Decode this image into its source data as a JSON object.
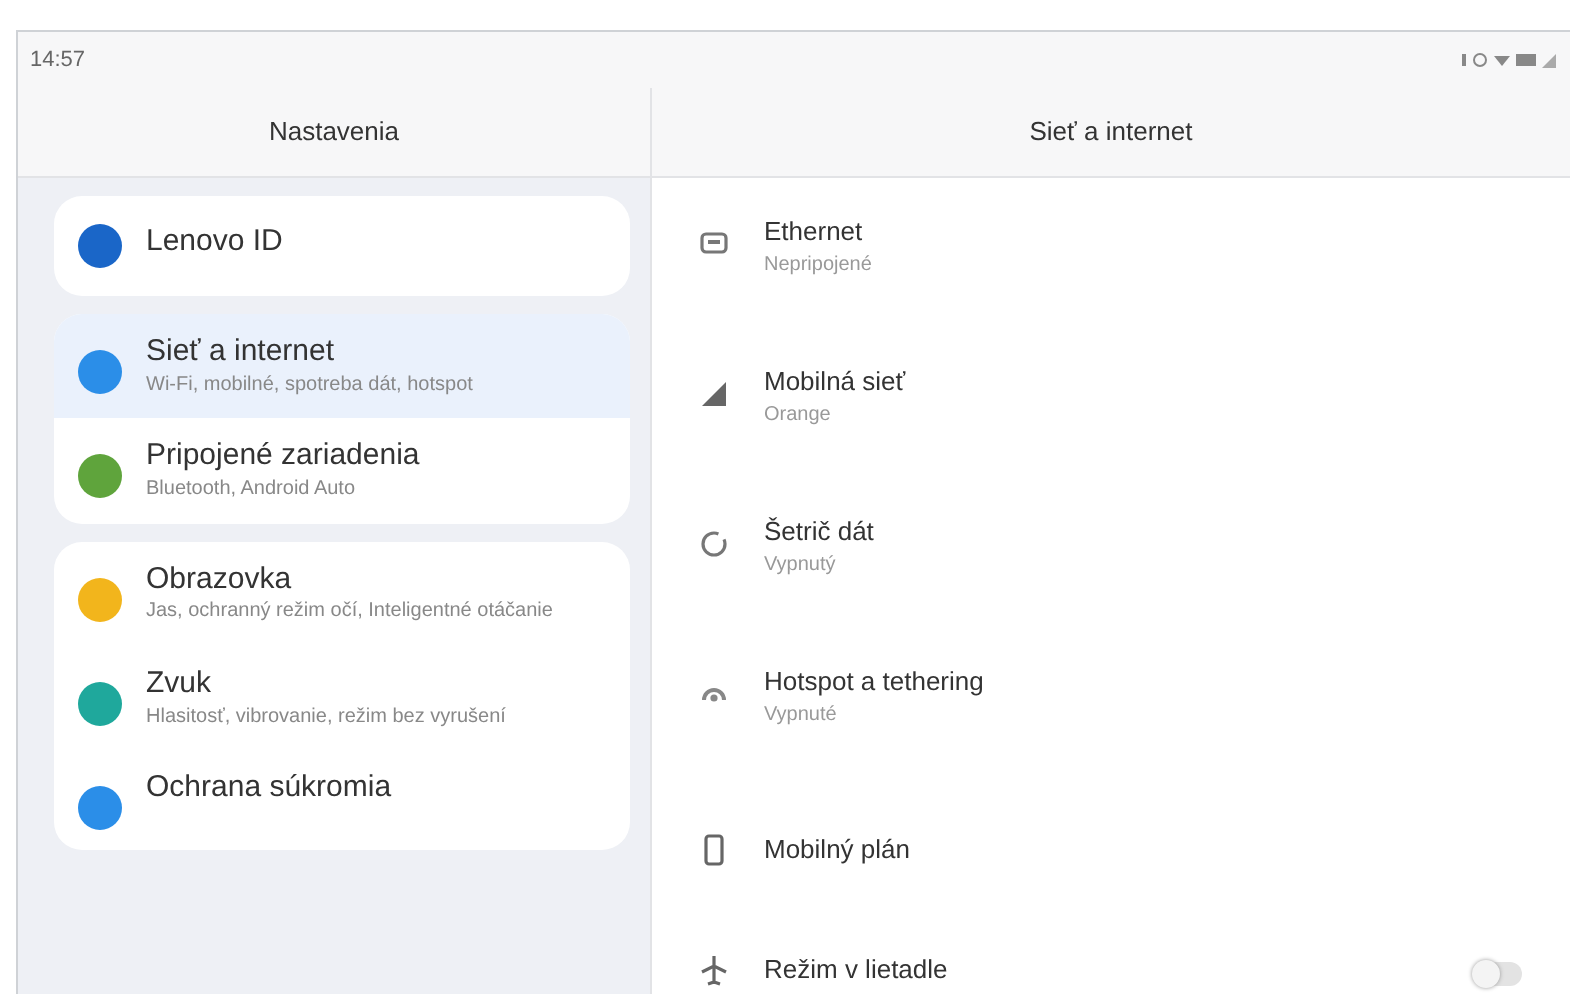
{
  "status_bar": {
    "time": "14:57"
  },
  "header": {
    "left_title": "Nastavenia",
    "right_title": "Sieť a internet"
  },
  "sidebar": {
    "groups": [
      {
        "items": [
          {
            "title": "Lenovo ID",
            "selected": false,
            "color": "#1a66c8"
          }
        ]
      },
      {
        "items": [
          {
            "title": "Sieť a internet",
            "subtitle": "Wi-Fi, mobilné, spotreba dát, hotspot",
            "selected": true,
            "color": "#2b8ee8"
          },
          {
            "title": "Pripojené zariadenia",
            "subtitle": "Bluetooth, Android Auto",
            "selected": false,
            "color": "#5fa43c"
          }
        ]
      },
      {
        "items": [
          {
            "title": "Obrazovka",
            "subtitle": "Jas, ochranný režim očí, Inteligentné otáčanie",
            "selected": false,
            "color": "#f2b51c"
          },
          {
            "title": "Zvuk",
            "subtitle": "Hlasitosť, vibrovanie, režim bez vyrušení",
            "selected": false,
            "color": "#1fa89c"
          },
          {
            "title": "Ochrana súkromia",
            "selected": false,
            "color": "#2b8ee8"
          }
        ]
      }
    ]
  },
  "settings": [
    {
      "title": "Ethernet",
      "subtitle": "Nepripojené"
    },
    {
      "title": "Mobilná sieť",
      "subtitle": "Orange"
    },
    {
      "title": "Šetrič dát",
      "subtitle": "Vypnutý"
    },
    {
      "title": "Hotspot a tethering",
      "subtitle": "Vypnuté"
    },
    {
      "title": "Mobilný plán"
    },
    {
      "title": "Režim v lietadle",
      "toggle": {
        "on": false
      }
    }
  ]
}
